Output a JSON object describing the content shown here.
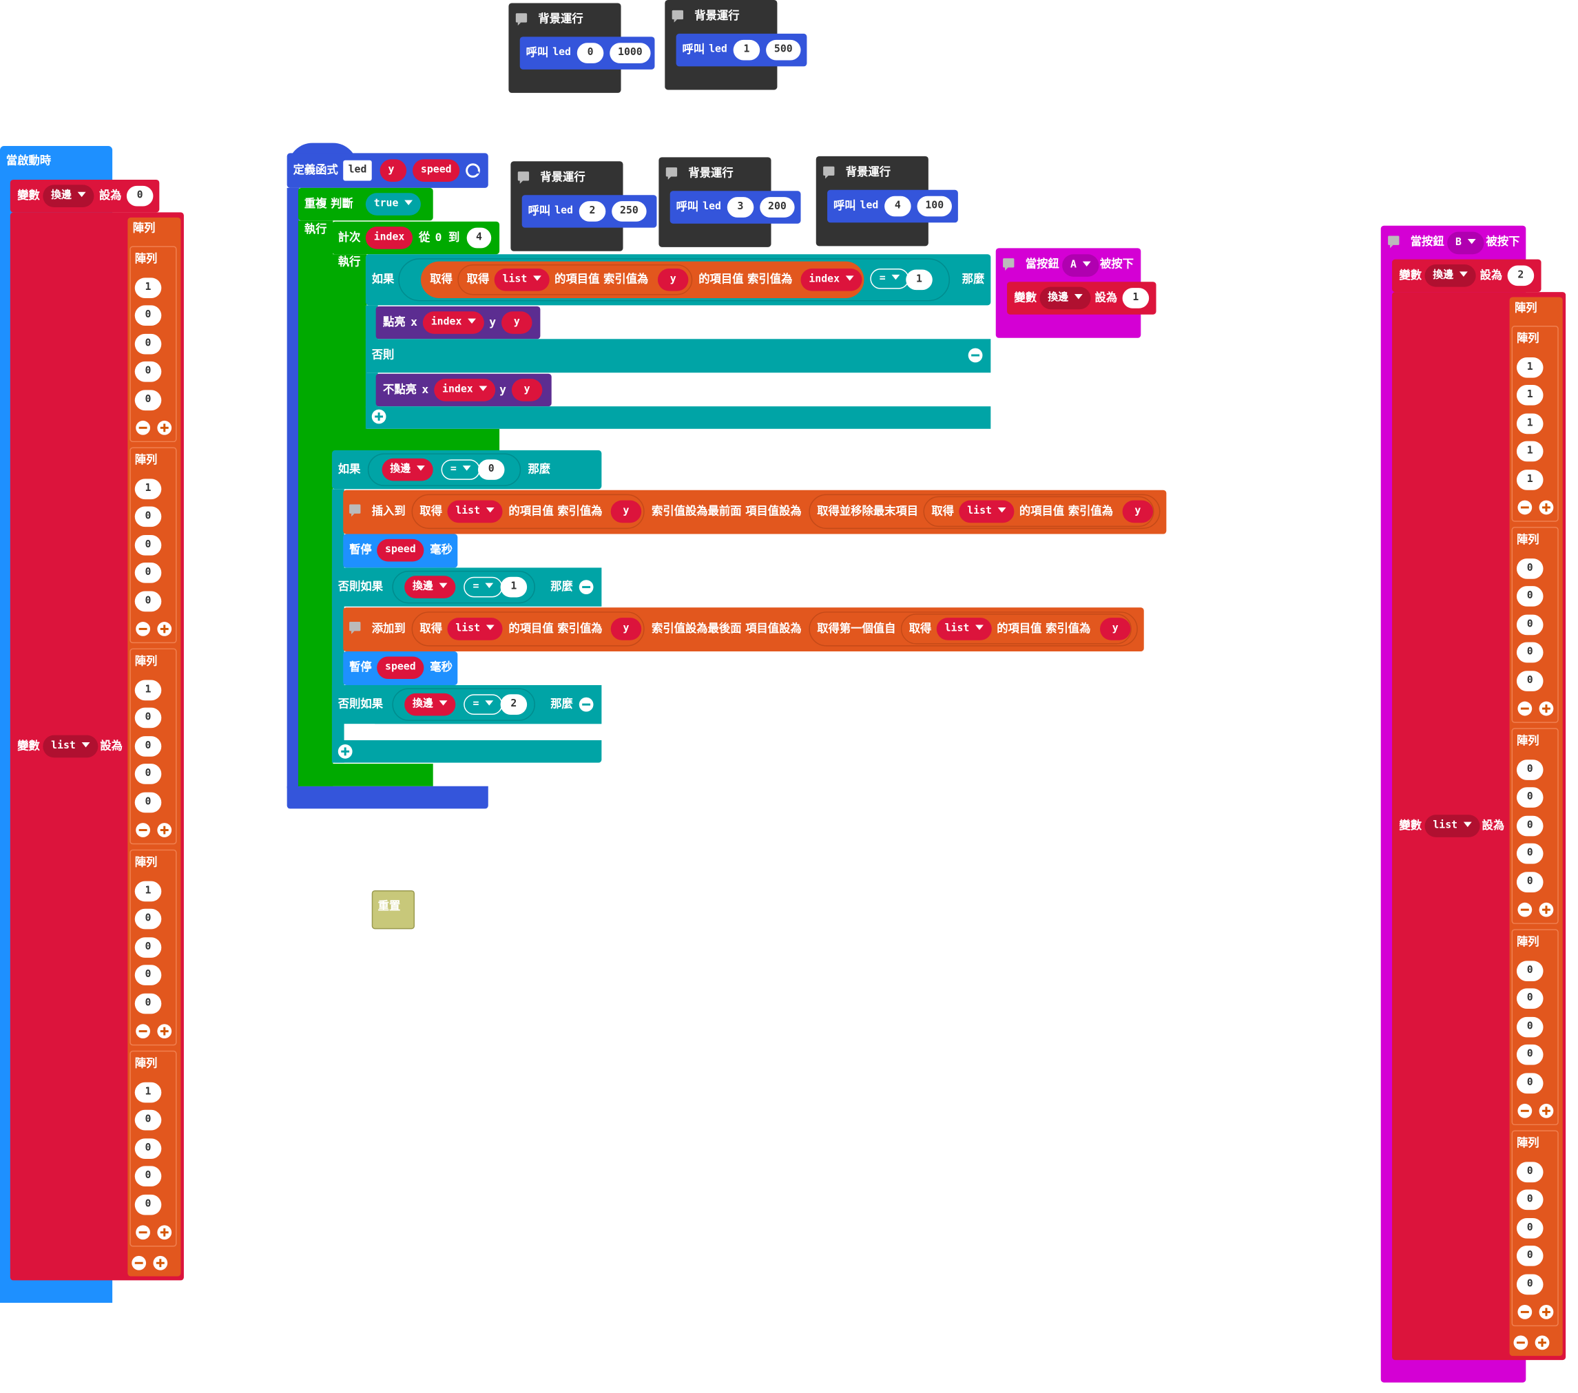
{
  "colors": {
    "event_blue": "#1e90ff",
    "variable_red": "#dc143c",
    "array_orange": "#e2571e",
    "function_blue": "#3455db",
    "loop_green": "#00aa00",
    "logic_teal": "#00a4a6",
    "led_purple": "#5c2d91",
    "background_dark": "#333333",
    "input_magenta": "#d400d4",
    "basic_olive": "#c8c87a"
  },
  "icons": [
    "comment-icon",
    "collapse-icon",
    "add-icon",
    "remove-icon",
    "dropdown-arrow-icon"
  ],
  "on_start": {
    "title": "當啟動時",
    "set1": {
      "kw": "變數",
      "var": "換邊",
      "set": "設為",
      "value": "0"
    },
    "set2": {
      "kw": "變數",
      "var": "list",
      "set": "設為"
    },
    "outer_label": "陣列",
    "rows_label": "陣列",
    "rows": [
      [
        "1",
        "0",
        "0",
        "0",
        "0"
      ],
      [
        "1",
        "0",
        "0",
        "0",
        "0"
      ],
      [
        "1",
        "0",
        "0",
        "0",
        "0"
      ],
      [
        "1",
        "0",
        "0",
        "0",
        "0"
      ],
      [
        "1",
        "0",
        "0",
        "0",
        "0"
      ]
    ]
  },
  "background_blocks": [
    {
      "title": "背景運行",
      "call": "呼叫",
      "fn": "led",
      "a": "0",
      "b": "1000"
    },
    {
      "title": "背景運行",
      "call": "呼叫",
      "fn": "led",
      "a": "1",
      "b": "500"
    },
    {
      "title": "背景運行",
      "call": "呼叫",
      "fn": "led",
      "a": "2",
      "b": "250"
    },
    {
      "title": "背景運行",
      "call": "呼叫",
      "fn": "led",
      "a": "3",
      "b": "200"
    },
    {
      "title": "背景運行",
      "call": "呼叫",
      "fn": "led",
      "a": "4",
      "b": "100"
    }
  ],
  "function_def": {
    "label": "定義函式",
    "name": "led",
    "param1": "y",
    "param2": "speed",
    "repeat_label": "重複 判斷",
    "bool": "true",
    "do_label": "執行",
    "for_label": "計次",
    "for_var": "index",
    "from_label": "從",
    "from_value": "0",
    "to_label": "到",
    "to_value": "4",
    "for_do": "執行",
    "if_label": "如果",
    "get": "取得",
    "list": "list",
    "item_at": "的項目值 索引值為",
    "y": "y",
    "index": "index",
    "eq": "=",
    "one": "1",
    "then": "那麼",
    "plot": "點亮",
    "unplot": "不點亮",
    "x": "x",
    "y_kw": "y",
    "else": "否則",
    "if2_label": "如果",
    "swap": "換邊",
    "zero": "0",
    "two": "2",
    "insert_to": "插入到",
    "insert_pos": "索引值設為最前面 項目值設為",
    "get_remove_last": "取得並移除最末項目",
    "pause": "暫停",
    "speed": "speed",
    "ms": "毫秒",
    "elseif": "否則如果",
    "add_to": "添加到",
    "add_pos": "索引值設為最後面 項目值設為",
    "get_first": "取得第一個值自"
  },
  "button_a": {
    "title": "當按鈕",
    "btn": "A",
    "pressed": "被按下",
    "kw": "變數",
    "var": "換邊",
    "set": "設為",
    "value": "1"
  },
  "button_b": {
    "title": "當按鈕",
    "btn": "B",
    "pressed": "被按下",
    "set1": {
      "kw": "變數",
      "var": "換邊",
      "set": "設為",
      "value": "2"
    },
    "set2": {
      "kw": "變數",
      "var": "list",
      "set": "設為"
    },
    "outer_label": "陣列",
    "rows_label": "陣列",
    "rows": [
      [
        "1",
        "1",
        "1",
        "1",
        "1"
      ],
      [
        "0",
        "0",
        "0",
        "0",
        "0"
      ],
      [
        "0",
        "0",
        "0",
        "0",
        "0"
      ],
      [
        "0",
        "0",
        "0",
        "0",
        "0"
      ],
      [
        "0",
        "0",
        "0",
        "0",
        "0"
      ]
    ]
  },
  "reset_block": {
    "label": "重置"
  }
}
